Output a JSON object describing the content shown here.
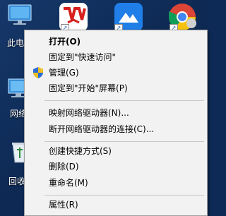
{
  "desktop": {
    "icons": [
      {
        "label": "此电"
      },
      {
        "label": "网络"
      },
      {
        "label": "回收"
      }
    ]
  },
  "taskbar_apps": [
    {
      "name": "wps-office-icon"
    },
    {
      "name": "lark-icon"
    },
    {
      "name": "chrome-icon"
    }
  ],
  "context_menu": {
    "items": [
      {
        "label": "打开(O)"
      },
      {
        "label": "固定到\"快速访问\""
      },
      {
        "label": "管理(G)"
      },
      {
        "label": "固定到\"开始\"屏幕(P)"
      },
      {
        "label": "映射网络驱动器(N)..."
      },
      {
        "label": "断开网络驱动器的连接(C)..."
      },
      {
        "label": "创建快捷方式(S)"
      },
      {
        "label": "删除(D)"
      },
      {
        "label": "重命名(M)"
      },
      {
        "label": "属性(R)"
      }
    ]
  },
  "colors": {
    "menu_bg": "#f2f2f2",
    "desktop_bg": "#0e2a55",
    "wps_red": "#d7201d",
    "lark_blue": "#1f7ee8"
  }
}
